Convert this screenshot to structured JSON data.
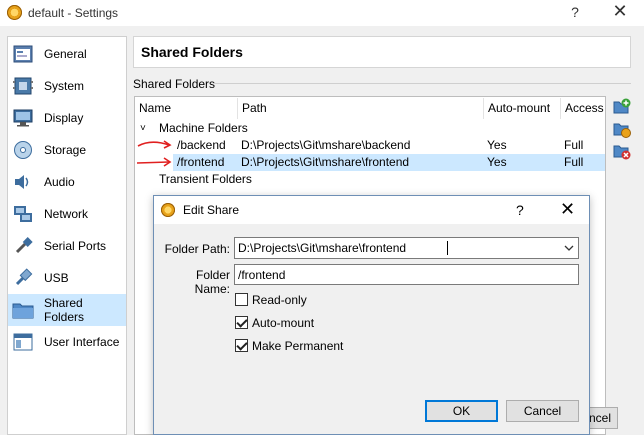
{
  "window": {
    "title": "default - Settings",
    "help": "?",
    "close": "✕"
  },
  "sidebar": {
    "items": [
      {
        "label": "General",
        "icon": "general-icon"
      },
      {
        "label": "System",
        "icon": "system-icon"
      },
      {
        "label": "Display",
        "icon": "display-icon"
      },
      {
        "label": "Storage",
        "icon": "storage-icon"
      },
      {
        "label": "Audio",
        "icon": "audio-icon"
      },
      {
        "label": "Network",
        "icon": "network-icon"
      },
      {
        "label": "Serial Ports",
        "icon": "serial-ports-icon"
      },
      {
        "label": "USB",
        "icon": "usb-icon"
      },
      {
        "label": "Shared Folders",
        "icon": "shared-folders-icon",
        "selected": true
      },
      {
        "label": "User Interface",
        "icon": "user-interface-icon"
      }
    ]
  },
  "main": {
    "title": "Shared Folders",
    "group_label": "Shared Folders",
    "columns": [
      "Name",
      "Path",
      "Auto-mount",
      "Access"
    ],
    "groups": {
      "machine": "Machine Folders",
      "transient": "Transient Folders"
    },
    "rows": [
      {
        "name": "/backend",
        "path": "D:\\Projects\\Git\\mshare\\backend",
        "automount": "Yes",
        "access": "Full"
      },
      {
        "name": "/frontend",
        "path": "D:\\Projects\\Git\\mshare\\frontend",
        "automount": "Yes",
        "access": "Full",
        "selected": true
      }
    ],
    "cancel_partial": "ncel"
  },
  "dialog": {
    "title": "Edit Share",
    "help": "?",
    "close": "✕",
    "folder_path_label": "Folder Path:",
    "folder_path_value": "D:\\Projects\\Git\\mshare\\frontend",
    "folder_name_label": "Folder Name:",
    "folder_name_value": "/frontend",
    "readonly_label": "Read-only",
    "readonly_checked": false,
    "automount_label": "Auto-mount",
    "automount_checked": true,
    "permanent_label": "Make Permanent",
    "permanent_checked": true,
    "ok_label": "OK",
    "cancel_label": "Cancel"
  },
  "colors": {
    "selection": "#cce8ff",
    "annotation_arrow": "#e02020",
    "default_button_border": "#0078d7"
  }
}
